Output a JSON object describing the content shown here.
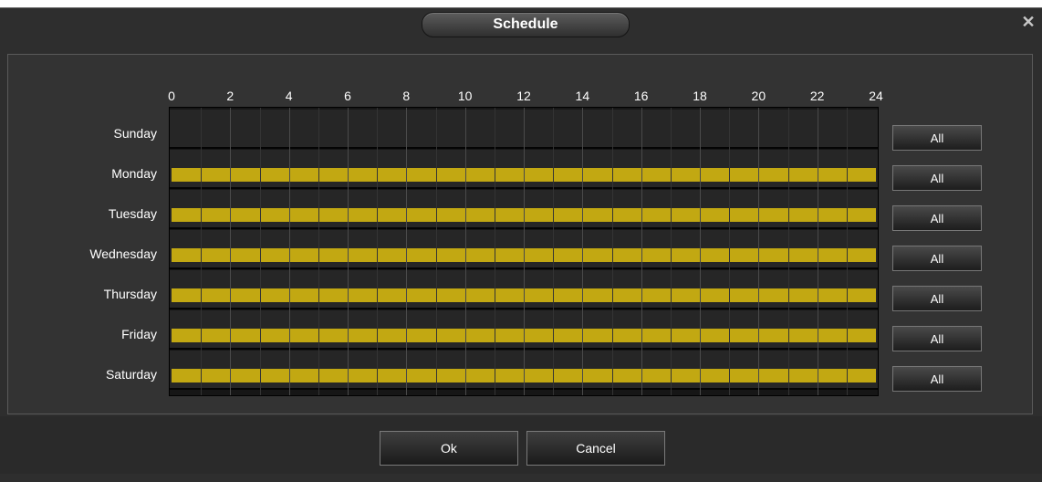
{
  "dialog": {
    "title": "Schedule",
    "close_icon": "close-icon"
  },
  "schedule": {
    "hour_labels": [
      "0",
      "2",
      "4",
      "6",
      "8",
      "10",
      "12",
      "14",
      "16",
      "18",
      "20",
      "22",
      "24"
    ],
    "days": [
      {
        "name": "Sunday",
        "enabled_hours": []
      },
      {
        "name": "Monday",
        "enabled_hours": [
          [
            0,
            24
          ]
        ]
      },
      {
        "name": "Tuesday",
        "enabled_hours": [
          [
            0,
            24
          ]
        ]
      },
      {
        "name": "Wednesday",
        "enabled_hours": [
          [
            0,
            24
          ]
        ]
      },
      {
        "name": "Thursday",
        "enabled_hours": [
          [
            0,
            24
          ]
        ]
      },
      {
        "name": "Friday",
        "enabled_hours": [
          [
            0,
            24
          ]
        ]
      },
      {
        "name": "Saturday",
        "enabled_hours": [
          [
            0,
            24
          ]
        ]
      }
    ],
    "all_button_label": "All",
    "bar_color": "#c2a812"
  },
  "footer": {
    "ok_label": "Ok",
    "cancel_label": "Cancel"
  }
}
